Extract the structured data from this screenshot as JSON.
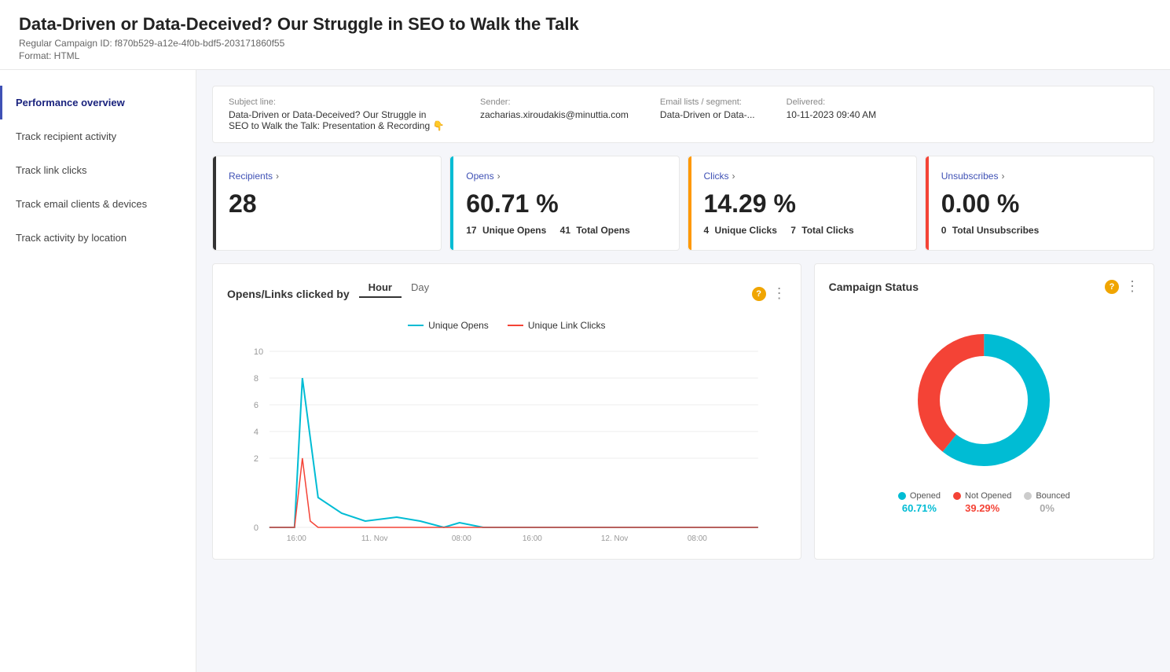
{
  "header": {
    "title": "Data-Driven or Data-Deceived? Our Struggle in SEO to Walk the Talk",
    "campaign_id_label": "Regular Campaign ID: f870b529-a12e-4f0b-bdf5-203171860f55",
    "format_label": "Format: HTML"
  },
  "sidebar": {
    "items": [
      {
        "id": "performance",
        "label": "Performance overview",
        "active": true
      },
      {
        "id": "recipient",
        "label": "Track recipient activity",
        "active": false
      },
      {
        "id": "link-clicks",
        "label": "Track link clicks",
        "active": false
      },
      {
        "id": "email-clients",
        "label": "Track email clients & devices",
        "active": false
      },
      {
        "id": "location",
        "label": "Track activity by location",
        "active": false
      }
    ]
  },
  "meta": {
    "subject_label": "Subject line:",
    "subject_value": "Data-Driven or Data-Deceived? Our Struggle in SEO to Walk the Talk: Presentation & Recording 👇",
    "sender_label": "Sender:",
    "sender_value": "zacharias.xiroudakis@minuttia.com",
    "list_label": "Email lists / segment:",
    "list_value": "Data-Driven or Data-...",
    "delivered_label": "Delivered:",
    "delivered_value": "10-11-2023 09:40 AM"
  },
  "stats": {
    "recipients": {
      "label": "Recipients",
      "value": "28",
      "sub": ""
    },
    "opens": {
      "label": "Opens",
      "percent": "60.71 %",
      "unique_count": "17",
      "unique_label": "Unique Opens",
      "total_count": "41",
      "total_label": "Total Opens"
    },
    "clicks": {
      "label": "Clicks",
      "percent": "14.29 %",
      "unique_count": "4",
      "unique_label": "Unique Clicks",
      "total_count": "7",
      "total_label": "Total Clicks"
    },
    "unsubscribes": {
      "label": "Unsubscribes",
      "percent": "0.00 %",
      "total_count": "0",
      "total_label": "Total Unsubscribes"
    }
  },
  "opens_chart": {
    "title": "Opens/Links clicked by",
    "tab_hour": "Hour",
    "tab_day": "Day",
    "legend_unique_opens": "Unique Opens",
    "legend_unique_clicks": "Unique Link Clicks",
    "y_labels": [
      "10",
      "8",
      "6",
      "4",
      "2",
      "0"
    ],
    "x_labels": [
      "16:00",
      "11. Nov",
      "08:00",
      "16:00",
      "12. Nov",
      "08:00"
    ]
  },
  "campaign_status": {
    "title": "Campaign Status",
    "segments": [
      {
        "label": "Opened",
        "pct_label": "60.71%",
        "color": "teal",
        "degrees": 218
      },
      {
        "label": "Not Opened",
        "pct_label": "39.29%",
        "color": "red",
        "degrees": 141
      },
      {
        "label": "Bounced",
        "pct_label": "0%",
        "color": "gray",
        "degrees": 1
      }
    ]
  },
  "icons": {
    "help": "?",
    "more": "⋮",
    "chevron": "›",
    "three_dots": "⋮"
  }
}
